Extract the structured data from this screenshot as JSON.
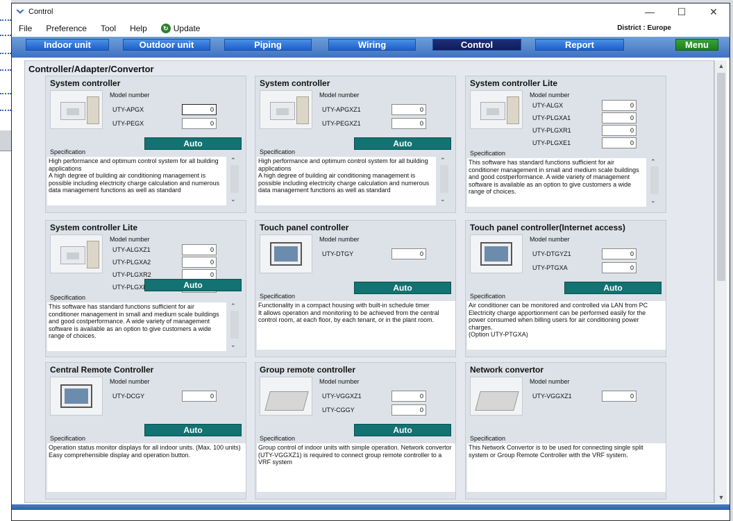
{
  "window": {
    "title": "Control"
  },
  "menubar": {
    "items": [
      "File",
      "Preference",
      "Tool",
      "Help",
      "Update"
    ],
    "district": "District : Europe"
  },
  "tabs": [
    "Indoor unit",
    "Outdoor unit",
    "Piping",
    "Wiring",
    "Control",
    "Report",
    "Menu"
  ],
  "active_tab": "Control",
  "section_title": "Controller/Adapter/Convertor",
  "labels": {
    "model_number": "Model number",
    "specification": "Specification",
    "auto": "Auto"
  },
  "cards": [
    {
      "title": "System controller",
      "models": [
        {
          "name": "UTY-APGX",
          "qty": "0"
        },
        {
          "name": "UTY-PEGX",
          "qty": "0"
        }
      ],
      "description": "High performance and optimum control system for all building applications\nA high degree of building air conditioning management is possible including electricity charge calculation and numerous data management functions as well as standard"
    },
    {
      "title": "System controller",
      "models": [
        {
          "name": "UTY-APGXZ1",
          "qty": "0"
        },
        {
          "name": "UTY-PEGXZ1",
          "qty": "0"
        }
      ],
      "description": "High performance and optimum control system for all building applications\nA high degree of building air conditioning management is possible including electricity charge calculation and numerous data management functions as well as standard"
    },
    {
      "title": "System controller Lite",
      "models": [
        {
          "name": "UTY-ALGX",
          "qty": "0"
        },
        {
          "name": "UTY-PLGXA1",
          "qty": "0"
        },
        {
          "name": "UTY-PLGXR1",
          "qty": "0"
        },
        {
          "name": "UTY-PLGXE1",
          "qty": "0"
        }
      ],
      "description": "This software has standard functions sufficient for air conditioner management in small and medium scale buildings and good costperformance. A wide variety of management software is available as an option to give customers a wide range of choices."
    },
    {
      "title": "System controller Lite",
      "models": [
        {
          "name": "UTY-ALGXZ1",
          "qty": "0"
        },
        {
          "name": "UTY-PLGXA2",
          "qty": "0"
        },
        {
          "name": "UTY-PLGXR2",
          "qty": "0"
        },
        {
          "name": "UTY-PLGXE2",
          "qty": "0"
        }
      ],
      "description": "This software has standard functions sufficient for air conditioner management in small and medium scale buildings and good costperformance. A wide variety of management software is available as an option to give customers a wide range of choices."
    },
    {
      "title": "Touch panel controller",
      "models": [
        {
          "name": "UTY-DTGY",
          "qty": "0"
        }
      ],
      "description": "Functionality in a compact housing with built-in schedule timer\nIt allows operation and monitoring to be achieved from the central control room, at each floor, by each tenant, or in the plant room."
    },
    {
      "title": "Touch panel controller(Internet access)",
      "models": [
        {
          "name": "UTY-DTGYZ1",
          "qty": "0"
        },
        {
          "name": "UTY-PTGXA",
          "qty": "0"
        }
      ],
      "description": "Air conditioner can be monitored and controlled via LAN from PC\nElectricity charge apportionment can be performed easily for the power consumed when billing users for air conditioning power charges.\n(Option UTY-PTGXA)"
    },
    {
      "title": "Central Remote Controller",
      "models": [
        {
          "name": "UTY-DCGY",
          "qty": "0"
        }
      ],
      "description": "Operation status monitor displays for all indoor units. (Max. 100 units)\nEasy comprehensible display and operation button."
    },
    {
      "title": "Group remote controller",
      "models": [
        {
          "name": "UTY-VGGXZ1",
          "qty": "0"
        },
        {
          "name": "UTY-CGGY",
          "qty": "0"
        }
      ],
      "description": "Group control of indoor units with simple operation. Network convertor (UTY-VGGXZ1) is required to connect group remote controller to a VRF system"
    },
    {
      "title": "Network convertor",
      "models": [
        {
          "name": "UTY-VGGXZ1",
          "qty": "0"
        }
      ],
      "description": "This Network Convertor is to be used for connecting single split system or Group Remote Controller with the VRF system."
    }
  ]
}
